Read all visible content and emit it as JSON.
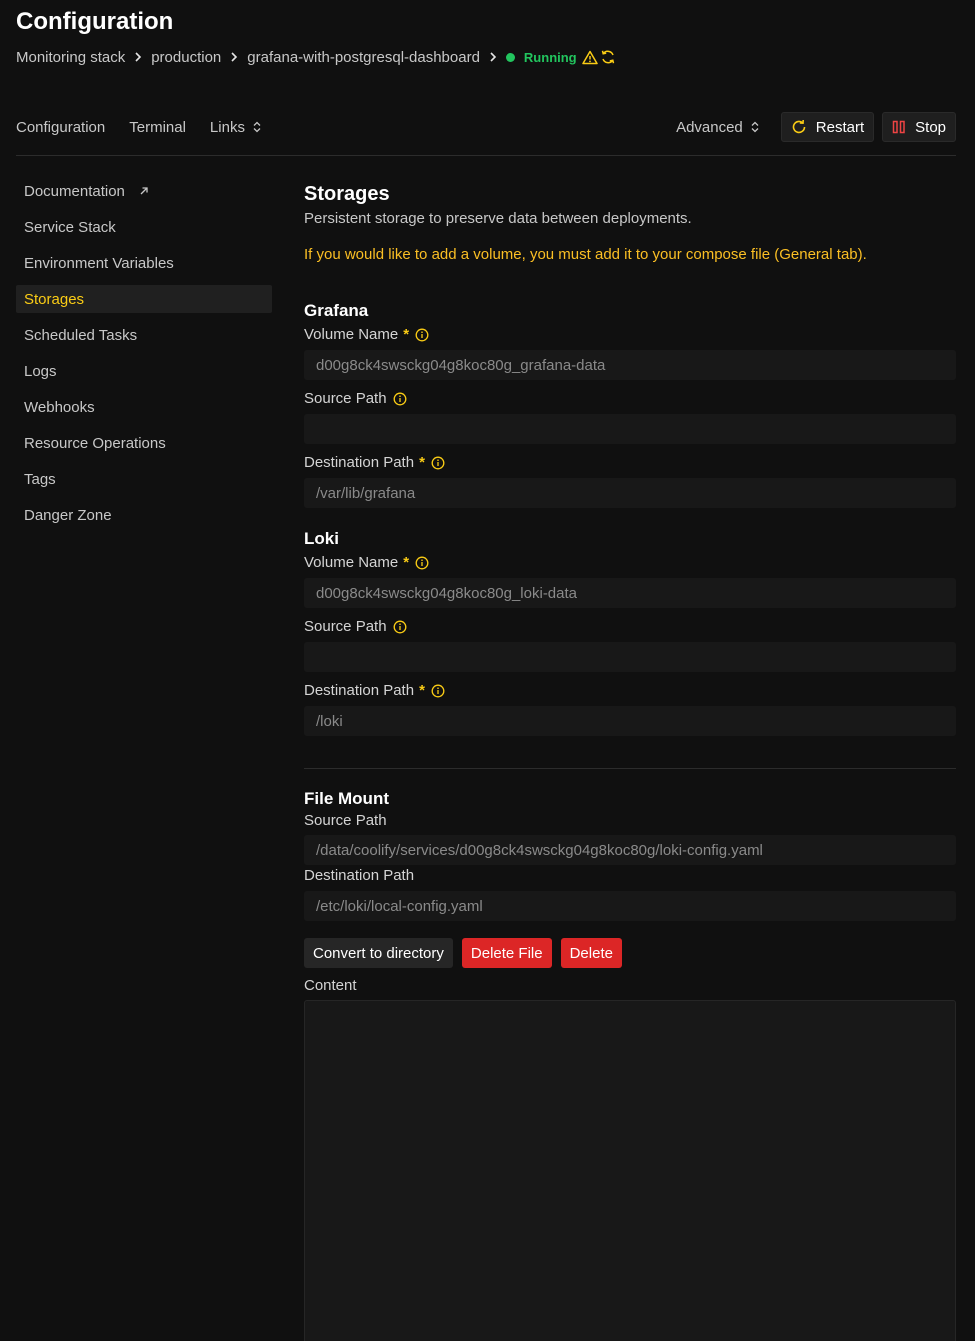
{
  "header": {
    "title": "Configuration",
    "breadcrumb": [
      "Monitoring stack",
      "production",
      "grafana-with-postgresql-dashboard"
    ],
    "status": "Running"
  },
  "top_nav": {
    "tabs": [
      "Configuration",
      "Terminal",
      "Links"
    ],
    "advanced": "Advanced",
    "restart": "Restart",
    "stop": "Stop"
  },
  "sidebar": {
    "items": [
      {
        "label": "Documentation"
      },
      {
        "label": "Service Stack"
      },
      {
        "label": "Environment Variables"
      },
      {
        "label": "Storages"
      },
      {
        "label": "Scheduled Tasks"
      },
      {
        "label": "Logs"
      },
      {
        "label": "Webhooks"
      },
      {
        "label": "Resource Operations"
      },
      {
        "label": "Tags"
      },
      {
        "label": "Danger Zone"
      }
    ],
    "active": "Storages"
  },
  "storages": {
    "title": "Storages",
    "subtitle": "Persistent storage to preserve data between deployments.",
    "warning": "If you would like to add a volume, you must add it to your compose file (General tab).",
    "volumes": [
      {
        "name": "Grafana",
        "volume_label": "Volume Name",
        "volume_value": "d00g8ck4swsckg04g8koc80g_grafana-data",
        "source_label": "Source Path",
        "source_value": "",
        "dest_label": "Destination Path",
        "dest_value": "/var/lib/grafana"
      },
      {
        "name": "Loki",
        "volume_label": "Volume Name",
        "volume_value": "d00g8ck4swsckg04g8koc80g_loki-data",
        "source_label": "Source Path",
        "source_value": "",
        "dest_label": "Destination Path",
        "dest_value": "/loki"
      }
    ],
    "required_mark": "*",
    "file_mount": {
      "title": "File Mount",
      "source_label": "Source Path",
      "source_value": "/data/coolify/services/d00g8ck4swsckg04g8koc80g/loki-config.yaml",
      "dest_label": "Destination Path",
      "dest_value": "/etc/loki/local-config.yaml",
      "buttons": {
        "convert": "Convert to directory",
        "delete_file": "Delete File",
        "delete": "Delete"
      },
      "content_label": "Content",
      "content_value": ""
    }
  },
  "colors": {
    "accent": "#facc15",
    "running": "#22c55e",
    "danger": "#dc2626",
    "background": "#101010"
  }
}
